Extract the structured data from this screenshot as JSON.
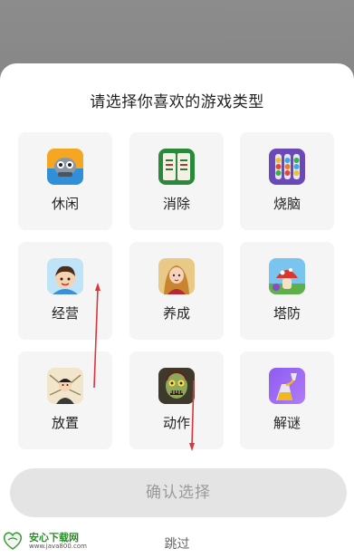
{
  "sheet": {
    "title": "请选择你喜欢的游戏类型",
    "categories": [
      {
        "label": "休闲",
        "icon": "gamepad-robot-icon"
      },
      {
        "label": "消除",
        "icon": "mahjong-tile-icon"
      },
      {
        "label": "烧脑",
        "icon": "color-tubes-icon"
      },
      {
        "label": "经营",
        "icon": "cartoon-boy-icon"
      },
      {
        "label": "养成",
        "icon": "girl-portrait-icon"
      },
      {
        "label": "塔防",
        "icon": "mushroom-monster-icon"
      },
      {
        "label": "放置",
        "icon": "swordsman-icon"
      },
      {
        "label": "动作",
        "icon": "zombie-icon"
      },
      {
        "label": "解谜",
        "icon": "pour-bottle-icon"
      }
    ],
    "confirm_label": "确认选择",
    "skip_label": "跳过"
  },
  "watermark": {
    "name": "安心下载网",
    "url": "www.java800.com",
    "logo_text": "安心"
  },
  "colors": {
    "backdrop": "#8a8a8a",
    "tile_bg": "#f5f5f5",
    "confirm_bg": "#e4e4e4",
    "arrow": "#d9363e"
  }
}
